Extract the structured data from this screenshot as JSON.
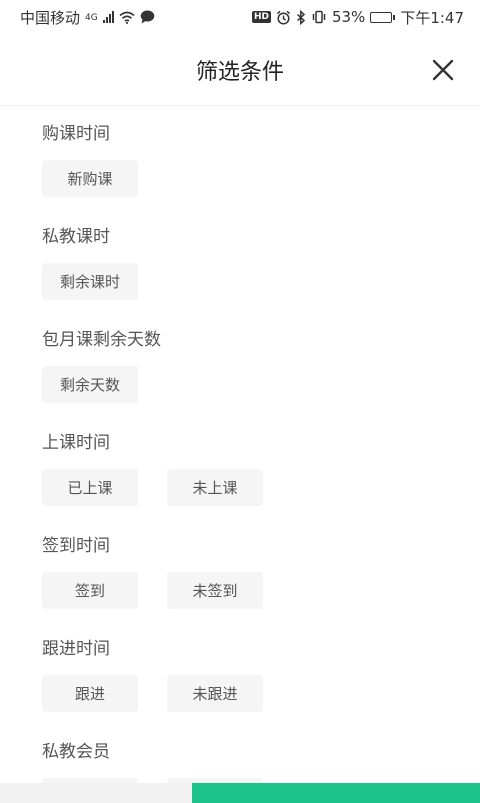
{
  "status_bar": {
    "carrier": "中国移动",
    "network": "4G",
    "battery": "53%",
    "battery_level": 0.53,
    "time": "下午1:47",
    "hd": "HD"
  },
  "header": {
    "title": "筛选条件"
  },
  "sections": [
    {
      "title": "购课时间",
      "options": [
        "新购课"
      ]
    },
    {
      "title": "私教课时",
      "options": [
        "剩余课时"
      ]
    },
    {
      "title": "包月课剩余天数",
      "options": [
        "剩余天数"
      ]
    },
    {
      "title": "上课时间",
      "options": [
        "已上课",
        "未上课"
      ]
    },
    {
      "title": "签到时间",
      "options": [
        "签到",
        "未签到"
      ]
    },
    {
      "title": "跟进时间",
      "options": [
        "跟进",
        "未跟进"
      ]
    },
    {
      "title": "私教会员",
      "options": [
        "",
        ""
      ]
    }
  ],
  "colors": {
    "accent": "#1ec28b",
    "chip_bg": "#f5f5f5"
  }
}
